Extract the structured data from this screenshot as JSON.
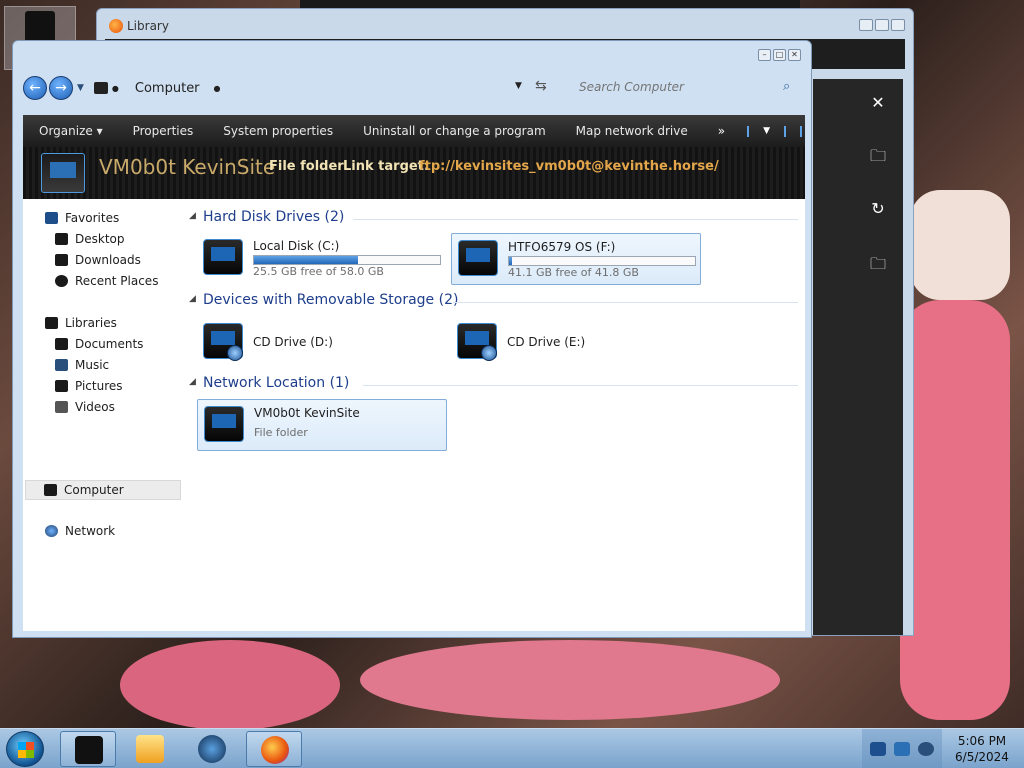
{
  "library_window": {
    "title": "Library"
  },
  "explorer": {
    "address": {
      "location": "Computer",
      "search_placeholder": "Search Computer"
    },
    "toolbar": {
      "organize": "Organize",
      "properties": "Properties",
      "system_properties": "System properties",
      "uninstall": "Uninstall or change a program",
      "map_network_drive": "Map network drive",
      "more": "»"
    },
    "details_pane": {
      "name": "VM0b0t KevinSite",
      "type": "File folder",
      "link_target_label": "Link target:",
      "link_target": "ftp://kevinsites_vm0b0t@kevinthe.horse/"
    },
    "nav": {
      "favorites": "Favorites",
      "desktop": "Desktop",
      "downloads": "Downloads",
      "recent_places": "Recent Places",
      "libraries": "Libraries",
      "documents": "Documents",
      "music": "Music",
      "pictures": "Pictures",
      "videos": "Videos",
      "computer": "Computer",
      "network": "Network"
    },
    "groups": {
      "hard_disks": "Hard Disk Drives (2)",
      "removable": "Devices with Removable Storage (2)",
      "network": "Network Location (1)"
    },
    "drives": [
      {
        "name": "Local Disk (C:)",
        "free": "25.5 GB free of 58.0 GB",
        "used_fraction": 0.56
      },
      {
        "name": "HTFO6579 OS (F:)",
        "free": "41.1 GB free of 41.8 GB",
        "used_fraction": 0.017
      }
    ],
    "removable": [
      {
        "name": "CD Drive (D:)"
      },
      {
        "name": "CD Drive (E:)"
      }
    ],
    "network_location": {
      "name": "VM0b0t KevinSite",
      "sub": "File folder"
    }
  },
  "taskbar": {
    "time": "5:06 PM",
    "date": "6/5/2024"
  }
}
